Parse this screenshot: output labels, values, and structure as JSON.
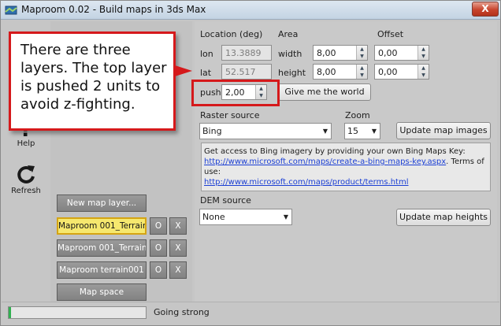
{
  "window": {
    "title": "Maproom 0.02 - Build maps in 3ds Max",
    "close_label": "X"
  },
  "toolbar": {
    "help_label": "Help",
    "refresh_label": "Refresh"
  },
  "layers": {
    "new_layer_label": "New map layer...",
    "items": [
      {
        "name": "Maproom 001_Terrain",
        "selected": true,
        "o_label": "O",
        "x_label": "X"
      },
      {
        "name": "Maproom 001_Terrain",
        "selected": false,
        "o_label": "O",
        "x_label": "X"
      },
      {
        "name": "Maproom terrain001",
        "selected": false,
        "o_label": "O",
        "x_label": "X"
      }
    ],
    "map_space_label": "Map space"
  },
  "location": {
    "heading": "Location (deg)",
    "lon_label": "lon",
    "lon_value": "13.3889",
    "lat_label": "lat",
    "lat_value": "52.517"
  },
  "area": {
    "heading": "Area",
    "width_label": "width",
    "width_value": "8,00",
    "height_label": "height",
    "height_value": "8,00"
  },
  "offset": {
    "heading": "Offset",
    "x_value": "0,00",
    "y_value": "0,00"
  },
  "push": {
    "label": "push",
    "value": "2,00"
  },
  "give_world_label": "Give me the world",
  "raster": {
    "label": "Raster source",
    "selected": "Bing"
  },
  "zoom": {
    "label": "Zoom",
    "selected": "15"
  },
  "update_images_label": "Update map images",
  "info": {
    "line1": "Get access to Bing imagery by providing your own Bing Maps Key:",
    "link1": "http://www.microsoft.com/maps/create-a-bing-maps-key.aspx",
    "mid": ". Terms of use:",
    "link2": "http://www.microsoft.com/maps/product/terms.html"
  },
  "dem": {
    "label": "DEM source",
    "selected": "None"
  },
  "update_heights_label": "Update map heights",
  "status": {
    "text": "Going strong",
    "progress": 0.02,
    "progress_color": "#30b050"
  },
  "callout": {
    "text": "There are three layers. The top layer is pushed 2 units to avoid z-fighting.",
    "color": "#d5191b"
  }
}
